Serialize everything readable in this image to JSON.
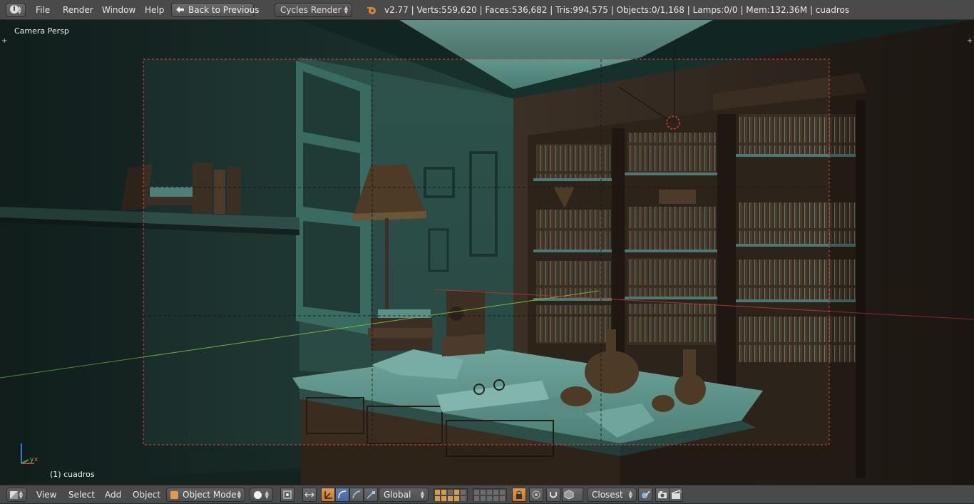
{
  "topbar": {
    "info_icon": "info-icon",
    "menus": [
      "File",
      "Render",
      "Window",
      "Help"
    ],
    "back_label": "Back to Previous",
    "engine": "Cycles Render",
    "stats": "v2.77 | Verts:559,620 | Faces:536,682 | Tris:994,575 | Objects:0/1,168 | Lamps:0/0 | Mem:132.36M | cuadros"
  },
  "viewport": {
    "view_name": "Camera Persp",
    "object_name": "(1) cuadros",
    "axis_y": "y",
    "axis_x": "x"
  },
  "bottombar": {
    "menus": [
      "View",
      "Select",
      "Add",
      "Object"
    ],
    "mode": "Object Mode",
    "orientation": "Global",
    "snap_target": "Closest"
  },
  "colors": {
    "header_bg": "#4a4a4a",
    "accent_orange": "#d99a4a",
    "scene_teal": "#2a4a45",
    "wood_brown": "#3d2f21"
  }
}
